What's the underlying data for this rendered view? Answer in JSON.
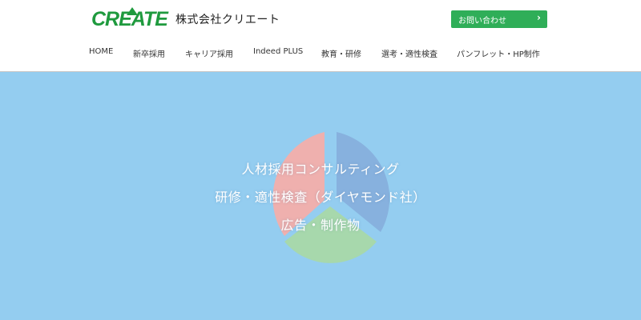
{
  "header": {
    "logo_text": "CREATE",
    "company_name": "株式会社クリエート",
    "contact_button": "お問い合わせ",
    "contact_arrow": "›"
  },
  "nav": {
    "items": [
      {
        "label": "HOME"
      },
      {
        "label": "新卒採用"
      },
      {
        "label": "キャリア採用"
      },
      {
        "label": "Indeed PLUS"
      },
      {
        "label": "教育・研修"
      },
      {
        "label": "選考・適性検査"
      },
      {
        "label": "パンフレット・HP制作"
      }
    ]
  },
  "hero": {
    "lines": [
      "人材採用コンサルティング",
      "研修・適性検査（ダイヤモンド社）",
      "広告・制作物"
    ],
    "colors": {
      "background": "#94cdf0",
      "segment_red": "#f3aeaa",
      "segment_blue": "#86afdc",
      "segment_green": "#a8d8a8"
    }
  },
  "colors": {
    "brand_green": "#1f9a3e",
    "button_green": "#2fae58"
  }
}
